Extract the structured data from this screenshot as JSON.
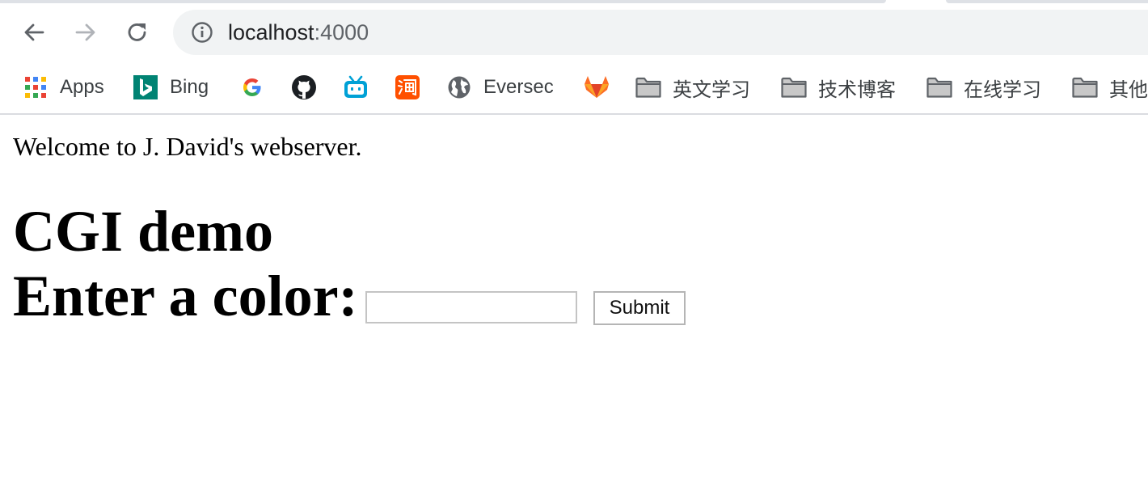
{
  "browser": {
    "url_host": "localhost",
    "url_port": ":4000",
    "nav": {
      "back_icon": "arrow-left-icon",
      "forward_icon": "arrow-right-icon",
      "reload_icon": "reload-icon",
      "site_info_icon": "info-icon"
    },
    "bookmarks": [
      {
        "label": "Apps",
        "icon": "apps-grid-icon"
      },
      {
        "label": "Bing",
        "icon": "bing-icon"
      },
      {
        "label": "",
        "icon": "google-icon"
      },
      {
        "label": "",
        "icon": "github-icon"
      },
      {
        "label": "",
        "icon": "bilibili-icon"
      },
      {
        "label": "",
        "icon": "taobao-icon"
      },
      {
        "label": "Eversec",
        "icon": "globe-icon"
      },
      {
        "label": "",
        "icon": "gitlab-icon"
      },
      {
        "label": "英文学习",
        "icon": "folder-icon"
      },
      {
        "label": "技术博客",
        "icon": "folder-icon"
      },
      {
        "label": "在线学习",
        "icon": "folder-icon"
      },
      {
        "label": "其他",
        "icon": "folder-icon"
      }
    ]
  },
  "page": {
    "welcome_text": "Welcome to J. David's webserver.",
    "heading": "CGI demo",
    "form_label": "Enter a color:",
    "color_input_value": "",
    "submit_label": "Submit"
  },
  "colors": {
    "omnibox_bg": "#f1f3f4",
    "text": "#000000",
    "bing_teal": "#008373",
    "gitlab_orange": "#fc6d26",
    "bilibili_blue": "#00a1d6",
    "taobao_orange": "#ff5000"
  }
}
